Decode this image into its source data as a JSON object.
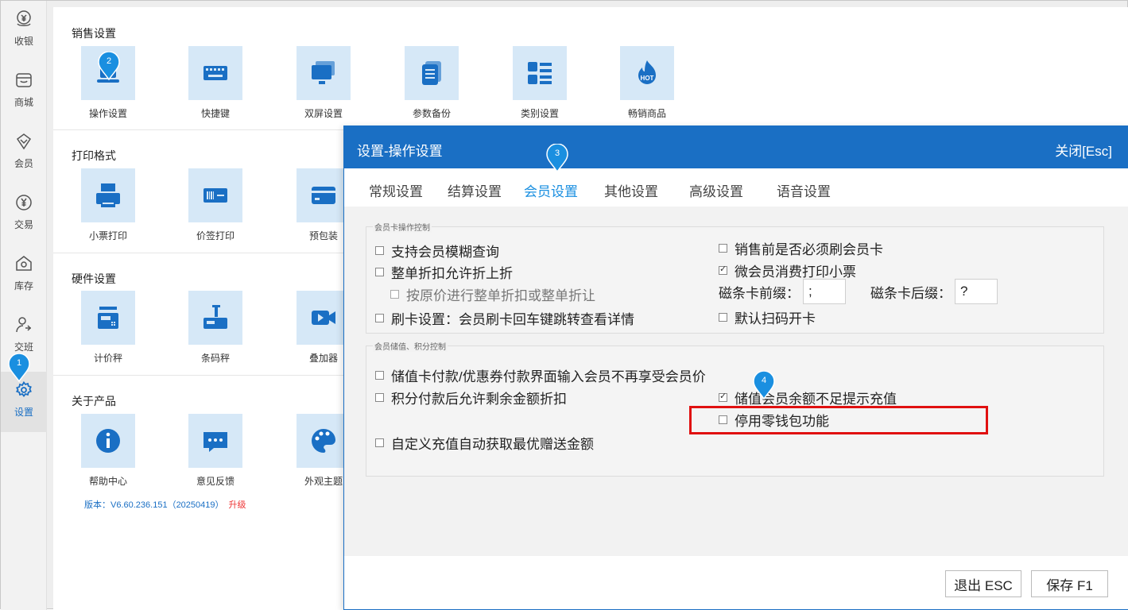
{
  "nav": {
    "items": [
      {
        "label": "收银",
        "icon": "cashier-icon"
      },
      {
        "label": "商城",
        "icon": "store-icon"
      },
      {
        "label": "会员",
        "icon": "member-icon"
      },
      {
        "label": "交易",
        "icon": "yuan-icon"
      },
      {
        "label": "库存",
        "icon": "inventory-icon"
      },
      {
        "label": "交班",
        "icon": "shift-icon"
      },
      {
        "label": "设置",
        "icon": "gear-icon"
      }
    ]
  },
  "sections": {
    "sales": {
      "title": "销售设置",
      "tiles": [
        "操作设置",
        "快捷键",
        "双屏设置",
        "参数备份",
        "类别设置",
        "畅销商品"
      ]
    },
    "print": {
      "title": "打印格式",
      "tiles": [
        "小票打印",
        "价签打印",
        "预包装"
      ]
    },
    "hardware": {
      "title": "硬件设置",
      "tiles": [
        "计价秤",
        "条码秤",
        "叠加器"
      ]
    },
    "about": {
      "title": "关于产品",
      "tiles": [
        "帮助中心",
        "意见反馈",
        "外观主题"
      ]
    }
  },
  "version": {
    "text": "版本：V6.60.236.151（20250419）",
    "upgrade": "升级"
  },
  "badges": {
    "b1": "1",
    "b2": "2",
    "b3": "3",
    "b4": "4"
  },
  "hot_label": "HOT",
  "dialog": {
    "title": "设置-操作设置",
    "close": "关闭[Esc]",
    "tabs": [
      "常规设置",
      "结算设置",
      "会员设置",
      "其他设置",
      "高级设置",
      "语音设置"
    ],
    "active_tab": "会员设置",
    "group1": {
      "legend": "会员卡操作控制",
      "left": [
        {
          "label": "支持会员模糊查询",
          "checked": false
        },
        {
          "label": "整单折扣允许折上折",
          "checked": false
        },
        {
          "label": "按原价进行整单折扣或整单折让",
          "checked": false
        },
        {
          "label": "刷卡设置：会员刷卡回车键跳转查看详情",
          "checked": false
        }
      ],
      "right": [
        {
          "label": "销售前是否必须刷会员卡",
          "checked": false
        },
        {
          "label": "微会员消费打印小票",
          "checked": true
        },
        {
          "label": "默认扫码开卡",
          "checked": false
        }
      ],
      "prefix_label": "磁条卡前缀：",
      "prefix_value": ";",
      "suffix_label": "磁条卡后缀：",
      "suffix_value": "?"
    },
    "group2": {
      "legend": "会员储值、积分控制",
      "options": [
        {
          "label": "储值卡付款/优惠券付款界面输入会员不再享受会员价",
          "checked": false
        },
        {
          "label": "积分付款后允许剩余金额折扣",
          "checked": false
        },
        {
          "label": "储值会员余额不足提示充值",
          "checked": true
        },
        {
          "label": "停用零钱包功能",
          "checked": false
        },
        {
          "label": "自定义充值自动获取最优赠送金额",
          "checked": false
        }
      ]
    },
    "buttons": {
      "exit": "退出 ESC",
      "save": "保存 F1"
    }
  },
  "colors": {
    "primary": "#1a6fc4",
    "tab_active": "#1a8fe0",
    "tile_bg": "#d6e8f7",
    "highlight": "#e01010"
  }
}
